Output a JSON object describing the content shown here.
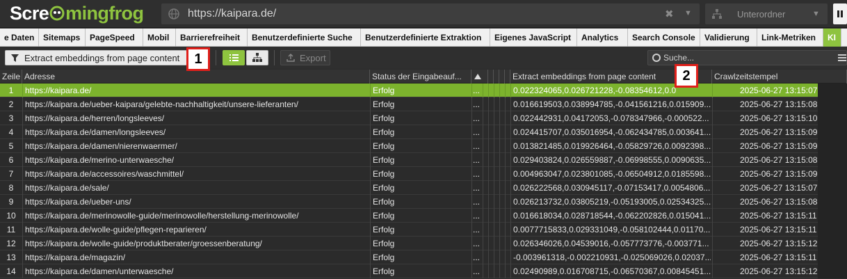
{
  "app": {
    "logo_part1": "Scre",
    "logo_part2": "mingfrog",
    "url": "https://kaipara.de/",
    "mode": "Unterordner"
  },
  "tabs": [
    {
      "label": "e Daten"
    },
    {
      "label": "Sitemaps"
    },
    {
      "label": "PageSpeed"
    },
    {
      "label": "Mobil"
    },
    {
      "label": "Barrierefreiheit"
    },
    {
      "label": "Benutzerdefinierte Suche"
    },
    {
      "label": "Benutzerdefinierte Extraktion"
    },
    {
      "label": "Eigenes JavaScript"
    },
    {
      "label": "Analytics"
    },
    {
      "label": "Search Console"
    },
    {
      "label": "Validierung"
    },
    {
      "label": "Link-Metriken"
    },
    {
      "label": "KI",
      "active": true
    }
  ],
  "toolbar": {
    "filter_label": "Extract embeddings from page content",
    "export_label": "Export",
    "search_placeholder": "Suche..."
  },
  "markers": {
    "one": "1",
    "two": "2"
  },
  "table": {
    "headers": {
      "row": "Zeile",
      "address": "Adresse",
      "status": "Status der Eingabeauf...",
      "embeddings": "Extract embeddings from page content",
      "timestamp": "Crawlzeitstempel"
    },
    "rows": [
      {
        "n": "1",
        "url": "https://kaipara.de/",
        "status": "Erfolg",
        "dots": "...",
        "emb": "0.022324065,0.026721228,-0.08354612,0.0",
        "time": "2025-06-27 13:15:07",
        "selected": true
      },
      {
        "n": "2",
        "url": "https://kaipara.de/ueber-kaipara/gelebte-nachhaltigkeit/unsere-lieferanten/",
        "status": "Erfolg",
        "dots": "...",
        "emb": "0.016619503,0.038994785,-0.041561216,0.015909...",
        "time": "2025-06-27 13:15:08"
      },
      {
        "n": "3",
        "url": "https://kaipara.de/herren/longsleeves/",
        "status": "Erfolg",
        "dots": "...",
        "emb": "0.022442931,0.04172053,-0.078347966,-0.000522...",
        "time": "2025-06-27 13:15:10"
      },
      {
        "n": "4",
        "url": "https://kaipara.de/damen/longsleeves/",
        "status": "Erfolg",
        "dots": "...",
        "emb": "0.024415707,0.035016954,-0.062434785,0.003641...",
        "time": "2025-06-27 13:15:09"
      },
      {
        "n": "5",
        "url": "https://kaipara.de/damen/nierenwaermer/",
        "status": "Erfolg",
        "dots": "...",
        "emb": "0.013821485,0.019926464,-0.05829726,0.0092398...",
        "time": "2025-06-27 13:15:09"
      },
      {
        "n": "6",
        "url": "https://kaipara.de/merino-unterwaesche/",
        "status": "Erfolg",
        "dots": "...",
        "emb": "0.029403824,0.026559887,-0.06998555,0.0090635...",
        "time": "2025-06-27 13:15:08"
      },
      {
        "n": "7",
        "url": "https://kaipara.de/accessoires/waschmittel/",
        "status": "Erfolg",
        "dots": "...",
        "emb": "0.004963047,0.023801085,-0.06504912,0.0185598...",
        "time": "2025-06-27 13:15:09"
      },
      {
        "n": "8",
        "url": "https://kaipara.de/sale/",
        "status": "Erfolg",
        "dots": "...",
        "emb": "0.026222568,0.030945117,-0.07153417,0.0054806...",
        "time": "2025-06-27 13:15:07"
      },
      {
        "n": "9",
        "url": "https://kaipara.de/ueber-uns/",
        "status": "Erfolg",
        "dots": "...",
        "emb": "0.026213732,0.03805219,-0.05193005,0.02534325...",
        "time": "2025-06-27 13:15:08"
      },
      {
        "n": "10",
        "url": "https://kaipara.de/merinowolle-guide/merinowolle/herstellung-merinowolle/",
        "status": "Erfolg",
        "dots": "...",
        "emb": "0.016618034,0.028718544,-0.062202826,0.015041...",
        "time": "2025-06-27 13:15:11"
      },
      {
        "n": "11",
        "url": "https://kaipara.de/wolle-guide/pflegen-reparieren/",
        "status": "Erfolg",
        "dots": "...",
        "emb": "0.0077715833,0.029331049,-0.058102444,0.01170...",
        "time": "2025-06-27 13:15:11"
      },
      {
        "n": "12",
        "url": "https://kaipara.de/wolle-guide/produktberater/groessenberatung/",
        "status": "Erfolg",
        "dots": "...",
        "emb": "0.026346026,0.04539016,-0.057773776,-0.003771...",
        "time": "2025-06-27 13:15:12"
      },
      {
        "n": "13",
        "url": "https://kaipara.de/magazin/",
        "status": "Erfolg",
        "dots": "...",
        "emb": "-0.003961318,-0.002210931,-0.025069026,0.02037...",
        "time": "2025-06-27 13:15:11"
      },
      {
        "n": "14",
        "url": "https://kaipara.de/damen/unterwaesche/",
        "status": "Erfolg",
        "dots": "...",
        "emb": "0.02490989,0.016708715,-0.06570367,0.00845451...",
        "time": "2025-06-27 13:15:12"
      }
    ]
  }
}
